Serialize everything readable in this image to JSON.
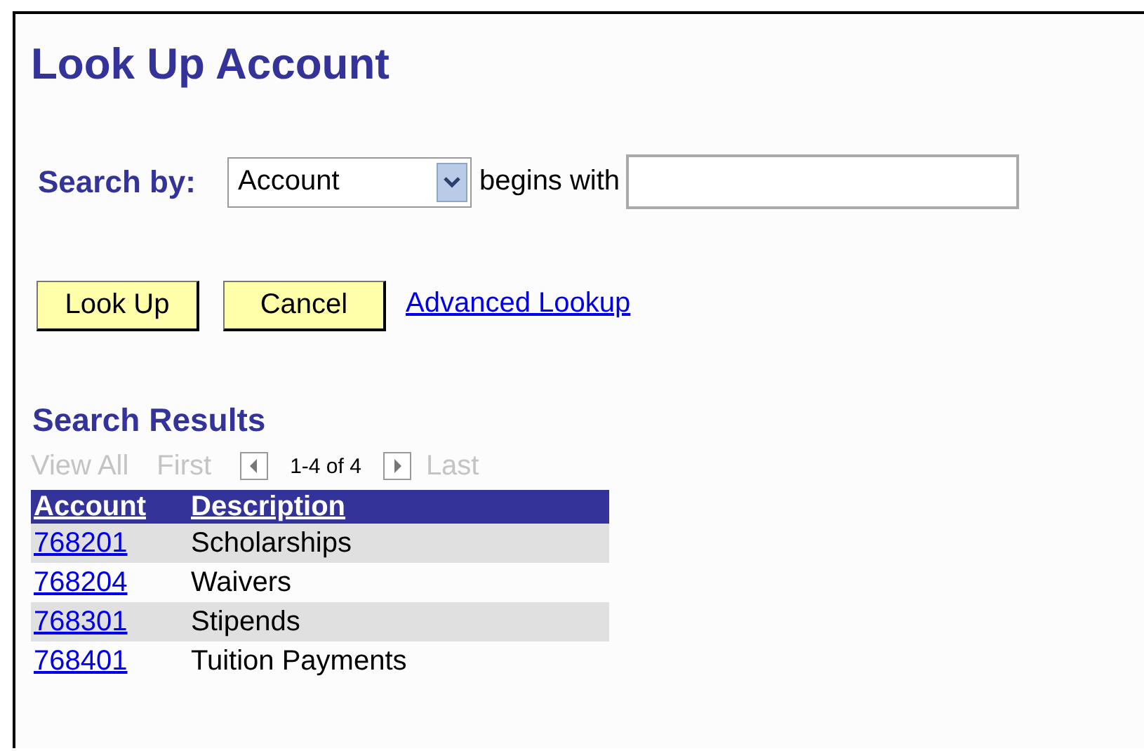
{
  "title": "Look Up Account",
  "search": {
    "label": "Search by:",
    "field": {
      "value": "Account"
    },
    "operator": "begins with"
  },
  "buttons": [
    {
      "label": "Look Up"
    },
    {
      "label": "Cancel"
    }
  ],
  "link": "Advanced Lookup",
  "results": {
    "title": "Search Results",
    "nav": [
      {
        "kind": "text",
        "label": "View All",
        "disabled": true
      },
      {
        "kind": "text",
        "label": "First",
        "disabled": true
      },
      {
        "kind": "prev",
        "disabled": true
      },
      {
        "kind": "count",
        "label": "1-4 of 4"
      },
      {
        "kind": "next",
        "disabled": true
      },
      {
        "kind": "text",
        "label": "Last",
        "disabled": true
      }
    ],
    "columns": [
      "Account",
      "Description"
    ],
    "rows": [
      {
        "account": "768201",
        "description": "Scholarships"
      },
      {
        "account": "768204",
        "description": "Waivers"
      },
      {
        "account": "768301",
        "description": "Stipends"
      },
      {
        "account": "768401",
        "description": "Tuition Payments"
      }
    ]
  }
}
